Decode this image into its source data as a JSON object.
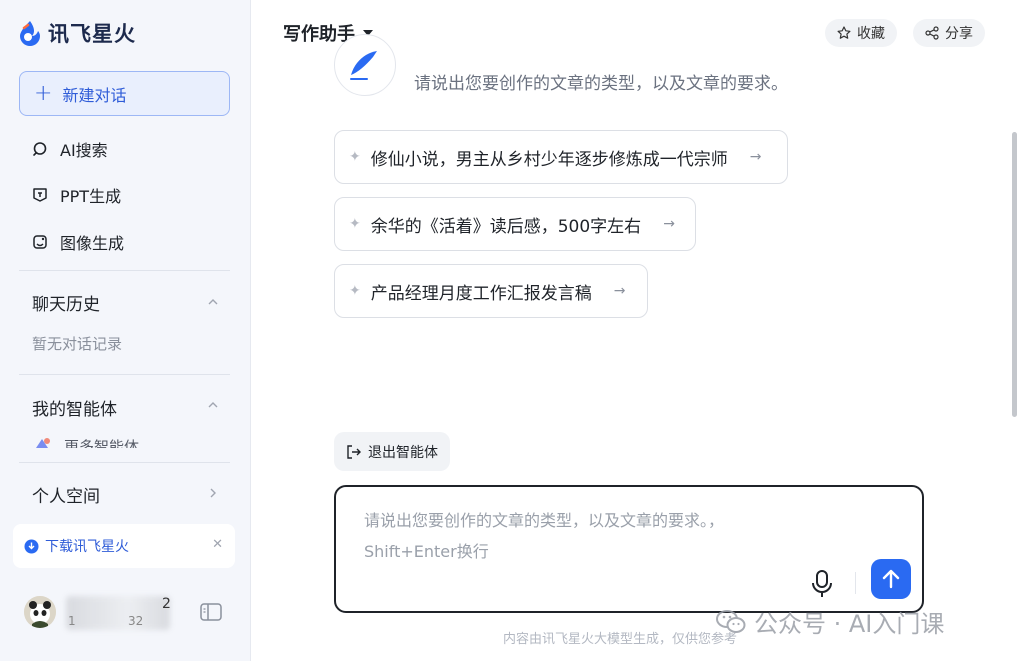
{
  "brand": {
    "name": "讯飞星火"
  },
  "sidebar": {
    "new_chat": "新建对话",
    "nav": [
      {
        "label": "AI搜索",
        "icon": "search-icon"
      },
      {
        "label": "PPT生成",
        "icon": "ppt-icon"
      },
      {
        "label": "图像生成",
        "icon": "image-gen-icon"
      }
    ],
    "history": {
      "title": "聊天历史",
      "empty": "暂无对话记录"
    },
    "agents": {
      "title": "我的智能体",
      "more": "更多智能体"
    },
    "personal_space": "个人空间",
    "download": "下载讯飞星火",
    "user": {
      "name_suffix": "2",
      "id_prefix": "1",
      "id_suffix": "32"
    }
  },
  "header": {
    "title": "写作助手",
    "favorite": "收藏",
    "share": "分享"
  },
  "chat": {
    "greeting": "请说出您要创作的文章的类型，以及文章的要求。",
    "suggestions": [
      "修仙小说，男主从乡村少年逐步修炼成一代宗师",
      "余华的《活着》读后感，500字左右",
      "产品经理月度工作汇报发言稿"
    ],
    "exit_agent": "退出智能体"
  },
  "composer": {
    "placeholder": "请说出您要创作的文章的类型，以及文章的要求。，\nShift+Enter换行"
  },
  "footer": {
    "note": "内容由讯飞星火大模型生成，仅供您参考"
  },
  "watermark": {
    "text": "公众号 · AI入门课"
  },
  "colors": {
    "accent": "#2a6af2",
    "new_chat_bg": "#e9effd",
    "sidebar_bg": "#f4f6fb"
  }
}
